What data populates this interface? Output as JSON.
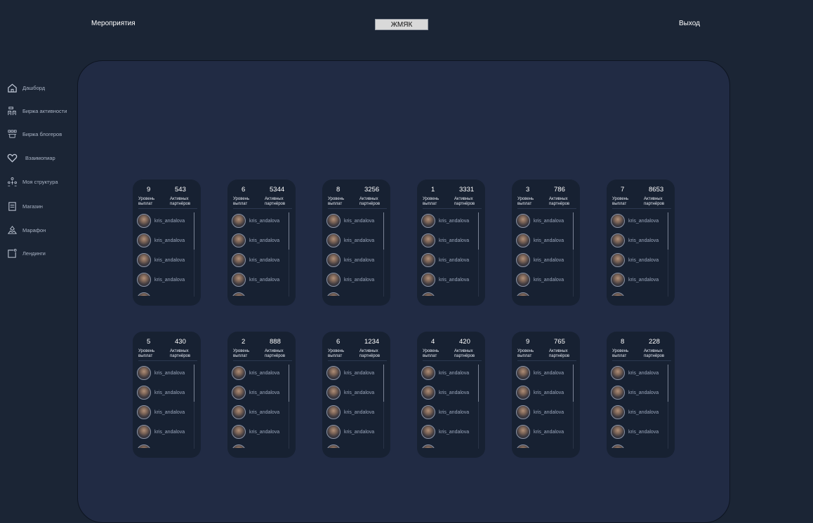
{
  "header": {
    "events_label": "Мероприятия",
    "center_button_label": "ЖМЯК",
    "logout_label": "Выход"
  },
  "sidebar": {
    "items": [
      {
        "label": "Дашборд",
        "icon": "home-icon"
      },
      {
        "label": "Биржа активности",
        "icon": "activity-exchange-icon"
      },
      {
        "label": "Биржа блогеров",
        "icon": "bloggers-exchange-icon"
      },
      {
        "label": "Взаимопиар",
        "icon": "heart-icon"
      },
      {
        "label": "Моя структура",
        "icon": "structure-icon"
      },
      {
        "label": "Магазин",
        "icon": "shop-icon"
      },
      {
        "label": "Марафон",
        "icon": "marathon-icon"
      },
      {
        "label": "Лендинги",
        "icon": "landing-icon"
      }
    ]
  },
  "card_labels": {
    "level": "Уровень выплат",
    "partners": "Активных партнёров"
  },
  "cards": [
    {
      "level": "9",
      "partners": "543",
      "users": [
        "kris_andalova",
        "kris_andalova",
        "kris_andalova",
        "kris_andalova"
      ]
    },
    {
      "level": "6",
      "partners": "5344",
      "users": [
        "kris_andalova",
        "kris_andalova",
        "kris_andalova",
        "kris_andalova"
      ]
    },
    {
      "level": "8",
      "partners": "3256",
      "users": [
        "kris_andalova",
        "kris_andalova",
        "kris_andalova",
        "kris_andalova"
      ]
    },
    {
      "level": "1",
      "partners": "3331",
      "users": [
        "kris_andalova",
        "kris_andalova",
        "kris_andalova",
        "kris_andalova"
      ]
    },
    {
      "level": "3",
      "partners": "786",
      "users": [
        "kris_andalova",
        "kris_andalova",
        "kris_andalova",
        "kris_andalova"
      ]
    },
    {
      "level": "7",
      "partners": "8653",
      "users": [
        "kris_andalova",
        "kris_andalova",
        "kris_andalova",
        "kris_andalova"
      ]
    },
    {
      "level": "5",
      "partners": "430",
      "users": [
        "kris_andalova",
        "kris_andalova",
        "kris_andalova",
        "kris_andalova"
      ]
    },
    {
      "level": "2",
      "partners": "888",
      "users": [
        "kris_andalova",
        "kris_andalova",
        "kris_andalova",
        "kris_andalova"
      ]
    },
    {
      "level": "6",
      "partners": "1234",
      "users": [
        "kris_andalova",
        "kris_andalova",
        "kris_andalova",
        "kris_andalova"
      ]
    },
    {
      "level": "4",
      "partners": "420",
      "users": [
        "kris_andalova",
        "kris_andalova",
        "kris_andalova",
        "kris_andalova"
      ]
    },
    {
      "level": "9",
      "partners": "765",
      "users": [
        "kris_andalova",
        "kris_andalova",
        "kris_andalova",
        "kris_andalova"
      ]
    },
    {
      "level": "8",
      "partners": "228",
      "users": [
        "kris_andalova",
        "kris_andalova",
        "kris_andalova",
        "kris_andalova"
      ]
    }
  ]
}
